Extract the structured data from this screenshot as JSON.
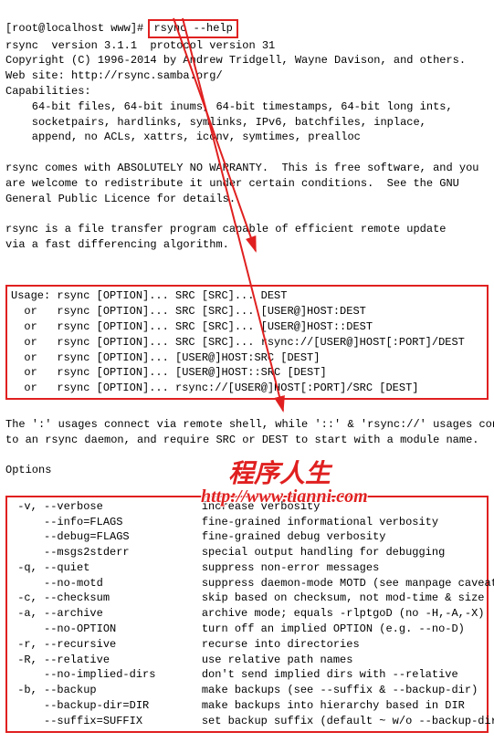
{
  "prompt": "[root@localhost www]# ",
  "command": "rsync --help",
  "header": [
    "rsync  version 3.1.1  protocol version 31",
    "Copyright (C) 1996-2014 by Andrew Tridgell, Wayne Davison, and others.",
    "Web site: http://rsync.samba.org/",
    "Capabilities:",
    "    64-bit files, 64-bit inums, 64-bit timestamps, 64-bit long ints,",
    "    socketpairs, hardlinks, symlinks, IPv6, batchfiles, inplace,",
    "    append, no ACLs, xattrs, iconv, symtimes, prealloc",
    "",
    "rsync comes with ABSOLUTELY NO WARRANTY.  This is free software, and you",
    "are welcome to redistribute it under certain conditions.  See the GNU",
    "General Public Licence for details.",
    "",
    "rsync is a file transfer program capable of efficient remote update",
    "via a fast differencing algorithm.",
    ""
  ],
  "usage_label": "Usage:",
  "usage": [
    " rsync [OPTION]... SRC [SRC]... DEST",
    " rsync [OPTION]... SRC [SRC]... [USER@]HOST:DEST",
    " rsync [OPTION]... SRC [SRC]... [USER@]HOST::DEST",
    " rsync [OPTION]... SRC [SRC]... rsync://[USER@]HOST[:PORT]/DEST",
    " rsync [OPTION]... [USER@]HOST:SRC [DEST]",
    " rsync [OPTION]... [USER@]HOST::SRC [DEST]",
    " rsync [OPTION]... rsync://[USER@]HOST[:PORT]/SRC [DEST]"
  ],
  "usage_or": "  or  ",
  "post_usage": [
    "The ':' usages connect via remote shell, while '::' & 'rsync://' usages conn",
    "to an rsync daemon, and require SRC or DEST to start with a module name.",
    "",
    "Options"
  ],
  "options": [
    " -v, --verbose               increase verbosity",
    "     --info=FLAGS            fine-grained informational verbosity",
    "     --debug=FLAGS           fine-grained debug verbosity",
    "     --msgs2stderr           special output handling for debugging",
    " -q, --quiet                 suppress non-error messages",
    "     --no-motd               suppress daemon-mode MOTD (see manpage caveat)",
    " -c, --checksum              skip based on checksum, not mod-time & size",
    " -a, --archive               archive mode; equals -rlptgoD (no -H,-A,-X)",
    "     --no-OPTION             turn off an implied OPTION (e.g. --no-D)",
    " -r, --recursive             recurse into directories",
    " -R, --relative              use relative path names",
    "     --no-implied-dirs       don't send implied dirs with --relative",
    " -b, --backup                make backups (see --suffix & --backup-dir)",
    "     --backup-dir=DIR        make backups into hierarchy based in DIR",
    "     --suffix=SUFFIX         set backup suffix (default ~ w/o --backup-dir)"
  ],
  "watermark": {
    "text1": "程序人生",
    "text2": "http://www.tianni.com"
  }
}
